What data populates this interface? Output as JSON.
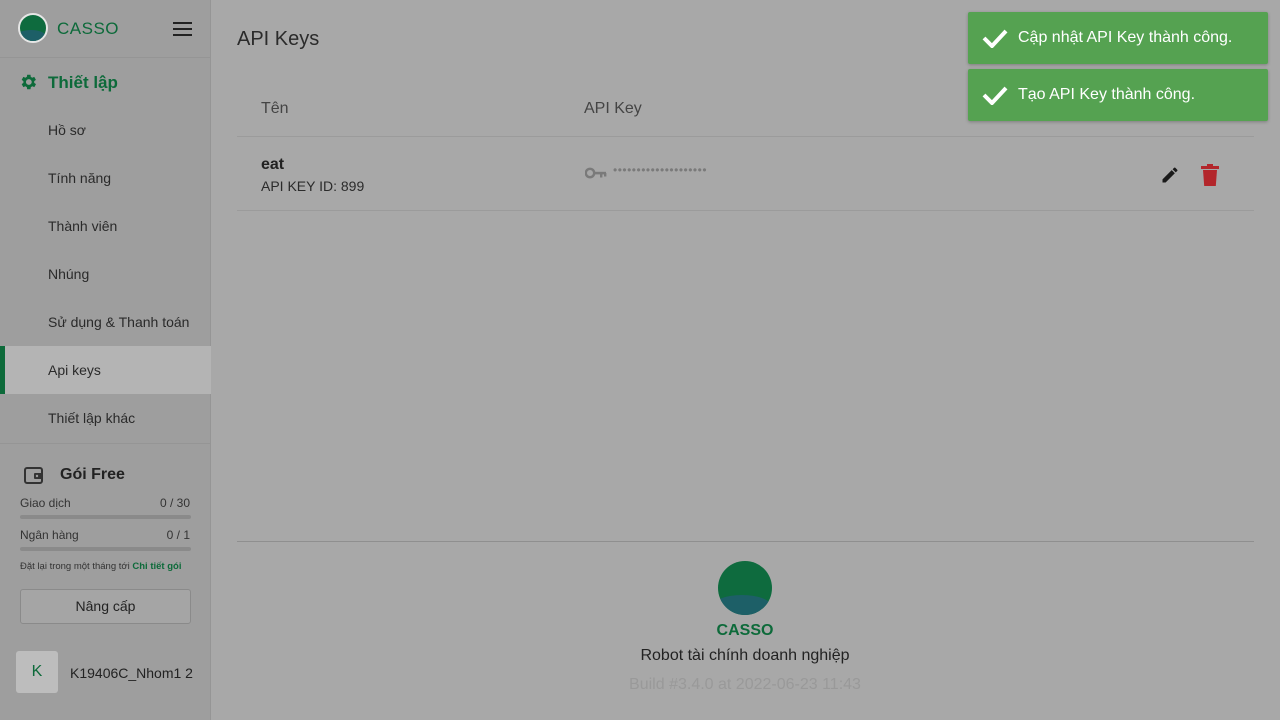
{
  "brand": {
    "name": "CASSO"
  },
  "sidebar": {
    "section_label": "Thiết lập",
    "items": [
      {
        "label": "Hồ sơ"
      },
      {
        "label": "Tính năng"
      },
      {
        "label": "Thành viên"
      },
      {
        "label": "Nhúng"
      },
      {
        "label": "Sử dụng & Thanh toán"
      },
      {
        "label": "Api keys",
        "active": true
      },
      {
        "label": "Thiết lập khác"
      }
    ],
    "plan": {
      "title": "Gói Free",
      "transactions_label": "Giao dịch",
      "transactions_value": "0 / 30",
      "transactions_progress": 0,
      "banks_label": "Ngân hàng",
      "banks_value": "0 / 1",
      "banks_progress": 0,
      "reset_note": "Đặt lại trong một tháng tới",
      "details_link": "Chi tiết gói",
      "upgrade_label": "Nâng cấp"
    },
    "user": {
      "initial": "K",
      "name": "K19406C_Nhom1 2"
    }
  },
  "main": {
    "title": "API Keys",
    "columns": {
      "name": "Tên",
      "api_key": "API Key"
    },
    "rows": [
      {
        "name": "eat",
        "id_text": "API KEY ID: 899",
        "masked_key": "••••••••••••••••••••"
      }
    ]
  },
  "footer": {
    "brand": "CASSO",
    "tagline": "Robot tài chính doanh nghiệp",
    "build": "Build #3.4.0 at 2022-06-23 11:43"
  },
  "toasts": [
    {
      "message": "Cập nhật API Key thành công."
    },
    {
      "message": "Tạo API Key thành công."
    }
  ],
  "colors": {
    "brand_green": "#0d6a3a",
    "toast_green": "#55a251",
    "delete_red": "#b3262b"
  }
}
